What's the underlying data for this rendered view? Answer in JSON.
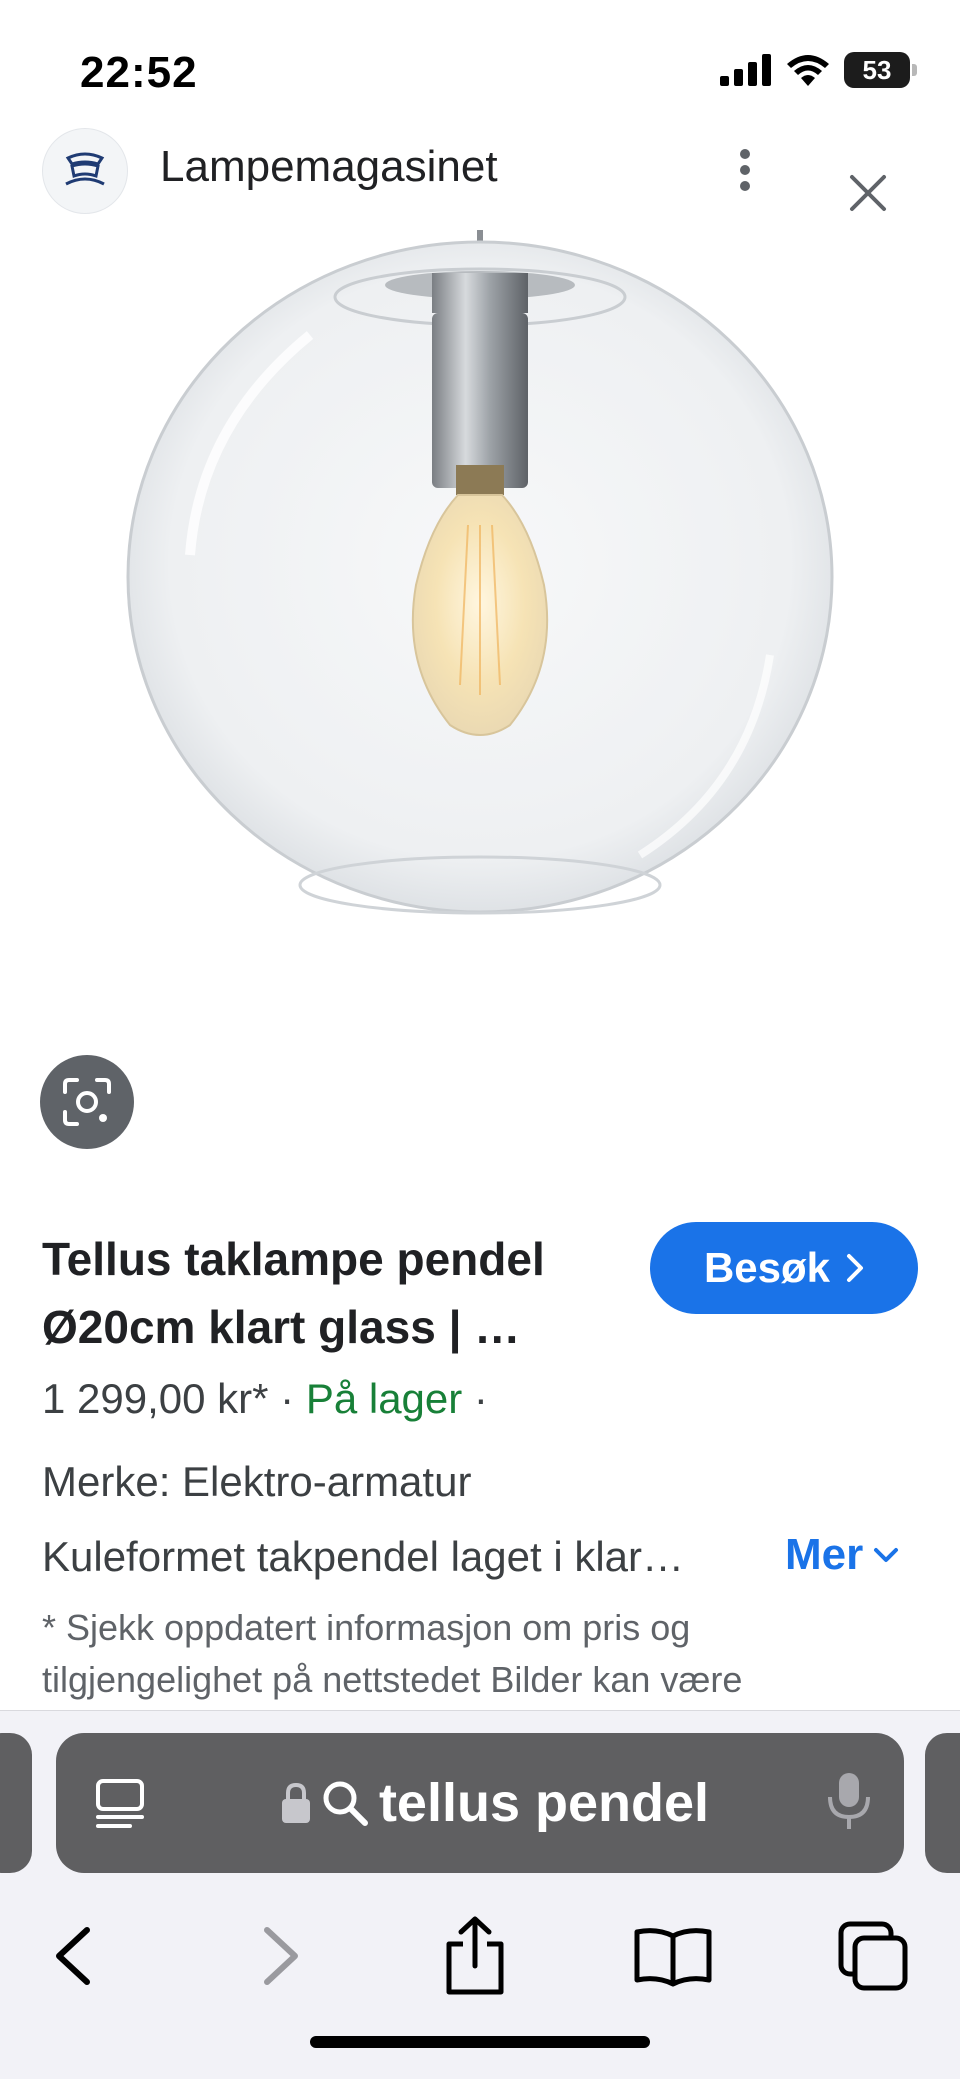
{
  "status_bar": {
    "time": "22:52",
    "battery": "53",
    "icons": [
      "signal-icon",
      "wifi-icon",
      "battery-icon"
    ]
  },
  "header": {
    "site_name": "Lampemagasinet",
    "logo_icon": "lamp-logo-icon",
    "menu_icon": "more-vert-icon",
    "close_icon": "close-icon"
  },
  "product": {
    "title": "Tellus taklampe pendel Ø20cm klart glass | …",
    "visit_label": "Besøk",
    "price": "1 299,00 kr*",
    "separator": " · ",
    "stock": "På lager",
    "trailing_separator": " ·",
    "brand": "Merke: Elektro-armatur",
    "description": "Kuleformet takpendel laget i klar…",
    "more_label": "Mer",
    "disclaimer": "* Sjekk oppdatert informasjon om pris og tilgjengelighet på nettstedet Bilder kan være"
  },
  "address_bar": {
    "query": "tellus pendel",
    "icons": [
      "reader-icon",
      "lock-icon",
      "search-icon",
      "mic-icon"
    ]
  },
  "toolbar": {
    "icons": [
      "back-icon",
      "forward-icon",
      "share-icon",
      "bookmarks-icon",
      "tabs-icon"
    ]
  },
  "colors": {
    "accent": "#1a73e8",
    "in_stock": "#188038",
    "chrome": "#5f5f61"
  }
}
